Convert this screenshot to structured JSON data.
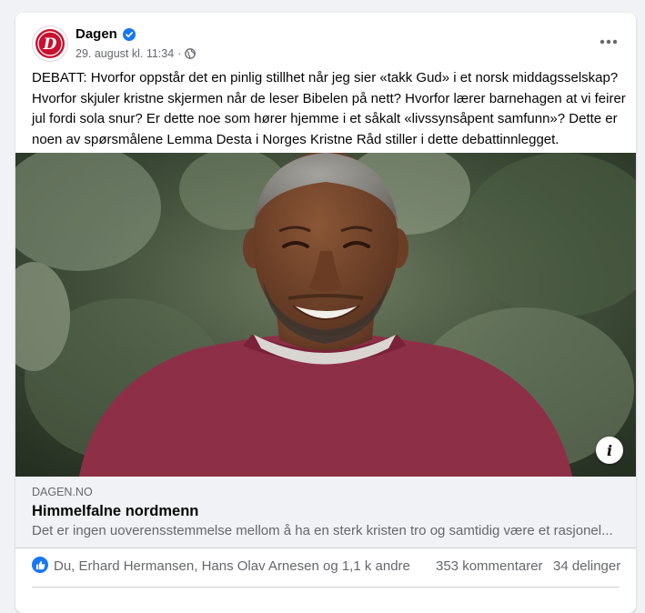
{
  "post": {
    "author": "Dagen",
    "verified_icon": "verified-badge-icon",
    "timestamp": "29. august kl. 11:34",
    "separator": "·",
    "audience_icon": "globe-icon",
    "more_icon": "more-horizontal-icon",
    "logo_letter": "D",
    "text": "DEBATT: Hvorfor oppstår det en pinlig stillhet når jeg sier «takk Gud» i et norsk middagsselskap? Hvorfor skjuler kristne skjermen når de leser Bibelen på nett? Hvorfor lærer barnehagen at vi feirer jul fordi sola snur? Er dette noe som hører hjemme i et såkalt «livssynsåpent samfunn»? Dette er noen av spørsmålene Lemma Desta i Norges Kristne Råd stiller i dette debattinnlegget."
  },
  "link": {
    "info_label": "i",
    "domain": "DAGEN.NO",
    "title": "Himmelfalne nordmenn",
    "description": "Det er ingen uoverensstemmelse mellom å ha en sterk kristen tro og samtidig være et rasjonel..."
  },
  "stats": {
    "reaction_icon": "like-icon",
    "reactors": "Du, Erhard Hermansen, Hans Olav Arnesen og 1,1 k andre",
    "comments": "353 kommentarer",
    "shares": "34 delinger"
  },
  "colors": {
    "accent": "#1877f2",
    "brand_red": "#c8102e",
    "sweater": "#8e2f48",
    "background": "#f0f2f5"
  }
}
